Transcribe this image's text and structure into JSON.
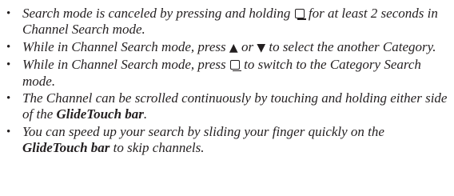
{
  "notes": [
    {
      "parts": [
        "Search mode is canceled by pressing and holding ",
        " for at least 2 seconds in Channel Search mode."
      ]
    },
    {
      "parts": [
        "While in Channel Search mode, press ",
        " or ",
        " to select the another Category."
      ],
      "up_arrow": "▲",
      "down_arrow": "▼"
    },
    {
      "parts": [
        "While in Channel Search mode, press ",
        " to switch to the Category Search mode."
      ]
    },
    {
      "parts": [
        "The Channel can be scrolled continuously by touching and holding either side of the ",
        "."
      ],
      "bold": "GlideTouch bar"
    },
    {
      "parts": [
        "You can speed up your search by sliding your finger quickly on the ",
        " to skip channels."
      ],
      "bold": "GlideTouch bar"
    }
  ],
  "bullet_char": "•",
  "icons": {
    "search_button": "search-button-icon"
  }
}
